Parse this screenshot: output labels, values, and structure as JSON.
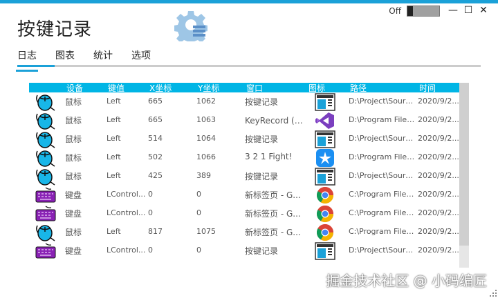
{
  "app": {
    "title": "按键记录"
  },
  "toggle": {
    "label": "Off"
  },
  "window": {
    "minimize": "—",
    "maximize": "☐",
    "close": "✕"
  },
  "tabs": [
    {
      "label": "日志"
    },
    {
      "label": "图表"
    },
    {
      "label": "统计"
    },
    {
      "label": "选项"
    }
  ],
  "grid": {
    "columns": [
      "设备",
      "键值",
      "X坐标",
      "Y坐标",
      "窗口",
      "图标",
      "路径",
      "时间"
    ],
    "rows": [
      {
        "device_icon": "mouse-icon",
        "device": "鼠标",
        "key": "Left",
        "x": "665",
        "y": "1062",
        "window": "按键记录",
        "app_icon": "app-window-icon",
        "path": "D:\\Project\\Sourc...",
        "time": "2020/9/2..."
      },
      {
        "device_icon": "mouse-icon",
        "device": "鼠标",
        "key": "Left",
        "x": "665",
        "y": "1063",
        "window": "KeyRecord (正...",
        "app_icon": "visual-studio-icon",
        "path": "D:\\Program Files...",
        "time": "2020/9/2..."
      },
      {
        "device_icon": "mouse-icon",
        "device": "鼠标",
        "key": "Left",
        "x": "514",
        "y": "1064",
        "window": "按键记录",
        "app_icon": "app-window-icon",
        "path": "D:\\Project\\Sourc...",
        "time": "2020/9/2..."
      },
      {
        "device_icon": "mouse-icon",
        "device": "鼠标",
        "key": "Left",
        "x": "502",
        "y": "1066",
        "window": "3 2 1 Fight!",
        "app_icon": "dingtalk-icon",
        "path": "D:\\Program Files...",
        "time": "2020/9/2..."
      },
      {
        "device_icon": "mouse-icon",
        "device": "鼠标",
        "key": "Left",
        "x": "425",
        "y": "389",
        "window": "按键记录",
        "app_icon": "app-window-icon",
        "path": "D:\\Project\\Sourc...",
        "time": "2020/9/2..."
      },
      {
        "device_icon": "keyboard-icon",
        "device": "键盘",
        "key": "LControl...",
        "x": "0",
        "y": "0",
        "window": "新标签页 - G...",
        "app_icon": "chrome-icon",
        "path": "C:\\Program Files...",
        "time": "2020/9/2..."
      },
      {
        "device_icon": "keyboard-icon",
        "device": "键盘",
        "key": "LControl...",
        "x": "0",
        "y": "0",
        "window": "新标签页 - G...",
        "app_icon": "chrome-icon",
        "path": "C:\\Program Files...",
        "time": "2020/9/2..."
      },
      {
        "device_icon": "mouse-icon",
        "device": "鼠标",
        "key": "Left",
        "x": "817",
        "y": "1075",
        "window": "新标签页 - G...",
        "app_icon": "chrome-icon",
        "path": "C:\\Program Files...",
        "time": "2020/9/2..."
      },
      {
        "device_icon": "keyboard-icon",
        "device": "键盘",
        "key": "LControl...",
        "x": "0",
        "y": "0",
        "window": "按键记录",
        "app_icon": "app-window-icon",
        "path": "D:\\Project\\Sourc...",
        "time": "2020/9/2..."
      }
    ]
  },
  "watermark": "掘金技术社区 @ 小码编匠",
  "colors": {
    "accent": "#1ba1d8",
    "header": "#00b5e5"
  }
}
